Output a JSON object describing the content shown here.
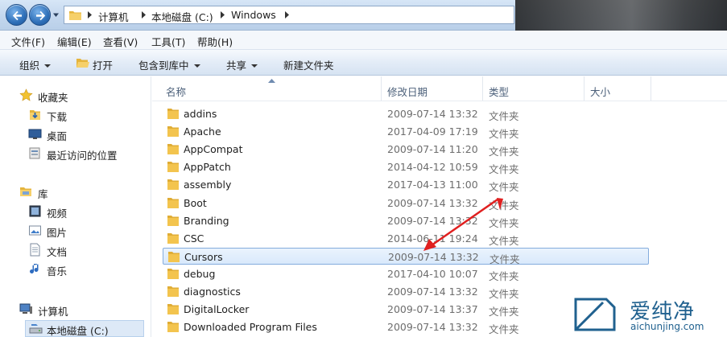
{
  "address_bar": {
    "crumbs": [
      "计算机",
      "本地磁盘 (C:)",
      "Windows"
    ]
  },
  "menu": [
    "文件(F)",
    "编辑(E)",
    "查看(V)",
    "工具(T)",
    "帮助(H)"
  ],
  "toolbar": {
    "organize": "组织",
    "open": "打开",
    "include_in_library": "包含到库中",
    "share": "共享",
    "new_folder": "新建文件夹"
  },
  "nav": {
    "favorites": "收藏夹",
    "downloads": "下载",
    "desktop": "桌面",
    "recent": "最近访问的位置",
    "libraries": "库",
    "videos": "视频",
    "pictures": "图片",
    "documents": "文档",
    "music": "音乐",
    "computer": "计算机",
    "local_disk": "本地磁盘 (C:)"
  },
  "columns": {
    "name": "名称",
    "date": "修改日期",
    "type": "类型",
    "size": "大小"
  },
  "files": [
    {
      "name": "addins",
      "date": "2009-07-14 13:32",
      "type": "文件夹"
    },
    {
      "name": "Apache",
      "date": "2017-04-09 17:19",
      "type": "文件夹"
    },
    {
      "name": "AppCompat",
      "date": "2009-07-14 11:20",
      "type": "文件夹"
    },
    {
      "name": "AppPatch",
      "date": "2014-04-12 10:59",
      "type": "文件夹"
    },
    {
      "name": "assembly",
      "date": "2017-04-13 11:00",
      "type": "文件夹"
    },
    {
      "name": "Boot",
      "date": "2009-07-14 13:32",
      "type": "文件夹"
    },
    {
      "name": "Branding",
      "date": "2009-07-14 13:32",
      "type": "文件夹"
    },
    {
      "name": "CSC",
      "date": "2014-06-11 19:24",
      "type": "文件夹"
    },
    {
      "name": "Cursors",
      "date": "2009-07-14 13:32",
      "type": "文件夹",
      "selected": true
    },
    {
      "name": "debug",
      "date": "2017-04-10 10:07",
      "type": "文件夹"
    },
    {
      "name": "diagnostics",
      "date": "2009-07-14 13:32",
      "type": "文件夹"
    },
    {
      "name": "DigitalLocker",
      "date": "2009-07-14 13:37",
      "type": "文件夹"
    },
    {
      "name": "Downloaded Program Files",
      "date": "2009-07-14 13:32",
      "type": "文件夹"
    }
  ],
  "watermark": {
    "brand": "爱纯净",
    "url": "aichunjing.com"
  },
  "colors": {
    "selection_bg": "#d9e9fb",
    "selection_border": "#84acdd",
    "annotation_arrow": "#e02020",
    "folder_yellow": "#f3c44e",
    "watermark_blue": "#20618f"
  },
  "icons": {
    "back": "back-arrow-icon",
    "forward": "forward-arrow-icon",
    "folder": "folder-icon",
    "favorites": "star-icon",
    "computer": "computer-icon",
    "drive": "drive-icon"
  }
}
